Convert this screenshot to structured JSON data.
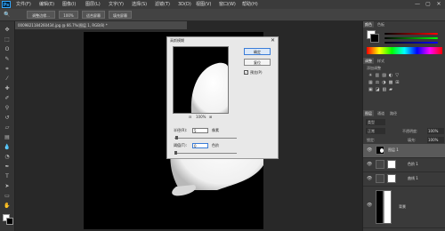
{
  "app": {
    "logo": "Ps"
  },
  "menubar": {
    "items": [
      "文件(F)",
      "编辑(E)",
      "图像(I)",
      "图层(L)",
      "文字(Y)",
      "选择(S)",
      "滤镜(T)",
      "3D(D)",
      "视图(V)",
      "窗口(W)",
      "帮助(H)"
    ]
  },
  "window_controls": {
    "minimize": "—",
    "maximize": "▢",
    "close": "✕"
  },
  "options_bar": {
    "buttons": [
      "调整边缘...",
      "100%",
      "适合屏幕",
      "填充屏幕"
    ]
  },
  "document": {
    "tab_title": "0009821184260434.jpg @ 66.7%(图层 1, RGB/8) *"
  },
  "dialog": {
    "title": "高斯模糊",
    "close": "✕",
    "ok_label": "确定",
    "reset_label": "复位",
    "preview_label": "预览(P)",
    "preview_checked": true,
    "zoom_out": "⊟",
    "zoom_level": "100%",
    "zoom_in": "⊞",
    "radius_label": "半径(R):",
    "radius_value": "5",
    "radius_unit": "像素",
    "threshold_label": "阈值(T):",
    "threshold_value": "0",
    "threshold_unit": "色阶"
  },
  "panels": {
    "color_tabs": [
      "颜色",
      "色板"
    ],
    "adjust_tabs": [
      "调整",
      "样式"
    ],
    "adjust_title": "添加调整",
    "layer_tabs": [
      "图层",
      "通道",
      "路径"
    ],
    "kind_label": "类型",
    "blend_mode": "正常",
    "opacity_label": "不透明度:",
    "opacity_value": "100%",
    "lock_label": "锁定:",
    "fill_label": "填充:",
    "fill_value": "100%",
    "layers": [
      {
        "name": "图层 1",
        "selected": true
      },
      {
        "name": "色阶 1",
        "selected": false
      },
      {
        "name": "曲线 1",
        "selected": false
      },
      {
        "name": "背景",
        "selected": false
      }
    ]
  },
  "colors": {
    "accent_blue": "#31a8ff",
    "canvas_black": "#000000"
  }
}
